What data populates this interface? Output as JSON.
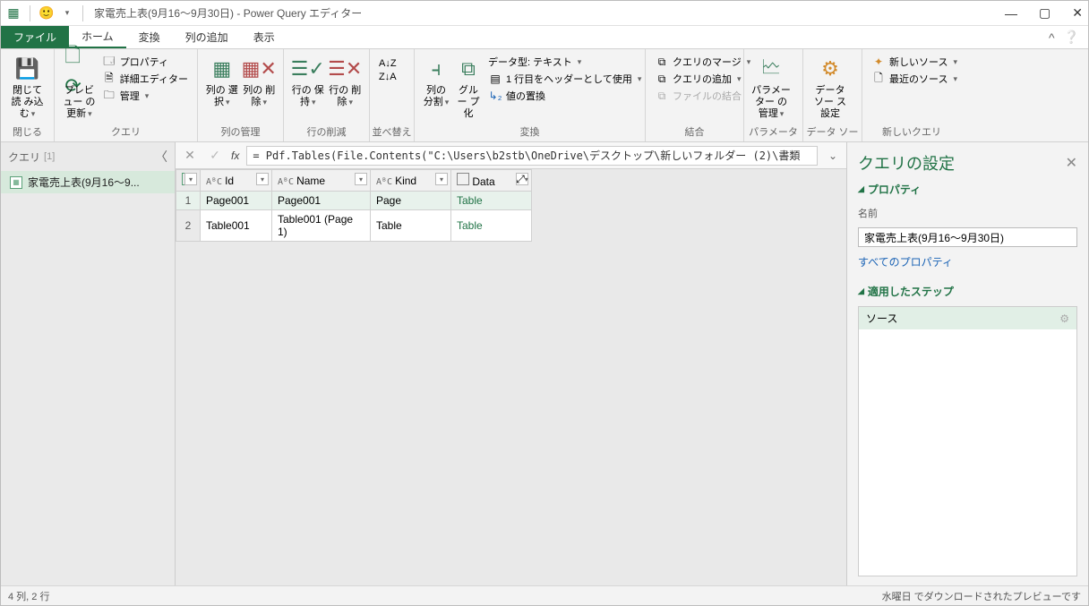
{
  "window": {
    "title": "家電売上表(9月16～9月30日) - Power Query エディター",
    "min": "—",
    "max": "▢",
    "close": "✕"
  },
  "tabs": {
    "file": "ファイル",
    "home": "ホーム",
    "transform": "変換",
    "addcol": "列の追加",
    "view": "表示"
  },
  "ribbon": {
    "close_group": "閉じる",
    "close_load": "閉じて読\nみ込む",
    "query_group": "クエリ",
    "preview_refresh": "プレビュー\nの更新",
    "properties": "プロパティ",
    "adv_editor": "詳細エディター",
    "manage": "管理",
    "col_manage_group": "列の管理",
    "col_select": "列の\n選択",
    "col_remove": "列の\n削除",
    "row_reduce_group": "行の削減",
    "row_keep": "行の\n保持",
    "row_remove": "行の\n削除",
    "sort_group": "並べ替え",
    "sort_asc": "A↓Z",
    "sort_desc": "Z↓A",
    "transform_group": "変換",
    "split_col": "列の\n分割",
    "group_by": "グルー\nプ化",
    "data_type": "データ型: テキスト",
    "first_row_header": "1 行目をヘッダーとして使用",
    "replace_values": "値の置換",
    "combine_group": "結合",
    "merge_queries": "クエリのマージ",
    "append_queries": "クエリの追加",
    "combine_files": "ファイルの結合",
    "param_group": "パラメーター",
    "param_manage": "パラメーター\nの管理",
    "ds_group": "データ ソース",
    "ds_settings": "データ ソー\nス設定",
    "newq_group": "新しいクエリ",
    "new_source": "新しいソース",
    "recent_source": "最近のソース"
  },
  "queries_panel": {
    "title": "クエリ",
    "count": "[1]",
    "item1": "家電売上表(9月16～9..."
  },
  "formula": "= Pdf.Tables(File.Contents(\"C:\\Users\\b2stb\\OneDrive\\デスクトップ\\新しいフォルダー (2)\\書類",
  "grid": {
    "headers": {
      "id": "Id",
      "name": "Name",
      "kind": "Kind",
      "data": "Data"
    },
    "rows": [
      {
        "n": "1",
        "id": "Page001",
        "name": "Page001",
        "kind": "Page",
        "data": "Table"
      },
      {
        "n": "2",
        "id": "Table001",
        "name": "Table001 (Page 1)",
        "kind": "Table",
        "data": "Table"
      }
    ]
  },
  "settings": {
    "title": "クエリの設定",
    "prop_section": "プロパティ",
    "name_label": "名前",
    "name_value": "家電売上表(9月16～9月30日)",
    "all_props": "すべてのプロパティ",
    "steps_section": "適用したステップ",
    "step_source": "ソース"
  },
  "status": {
    "left": "4 列, 2 行",
    "right": "水曜日 でダウンロードされたプレビューです"
  }
}
